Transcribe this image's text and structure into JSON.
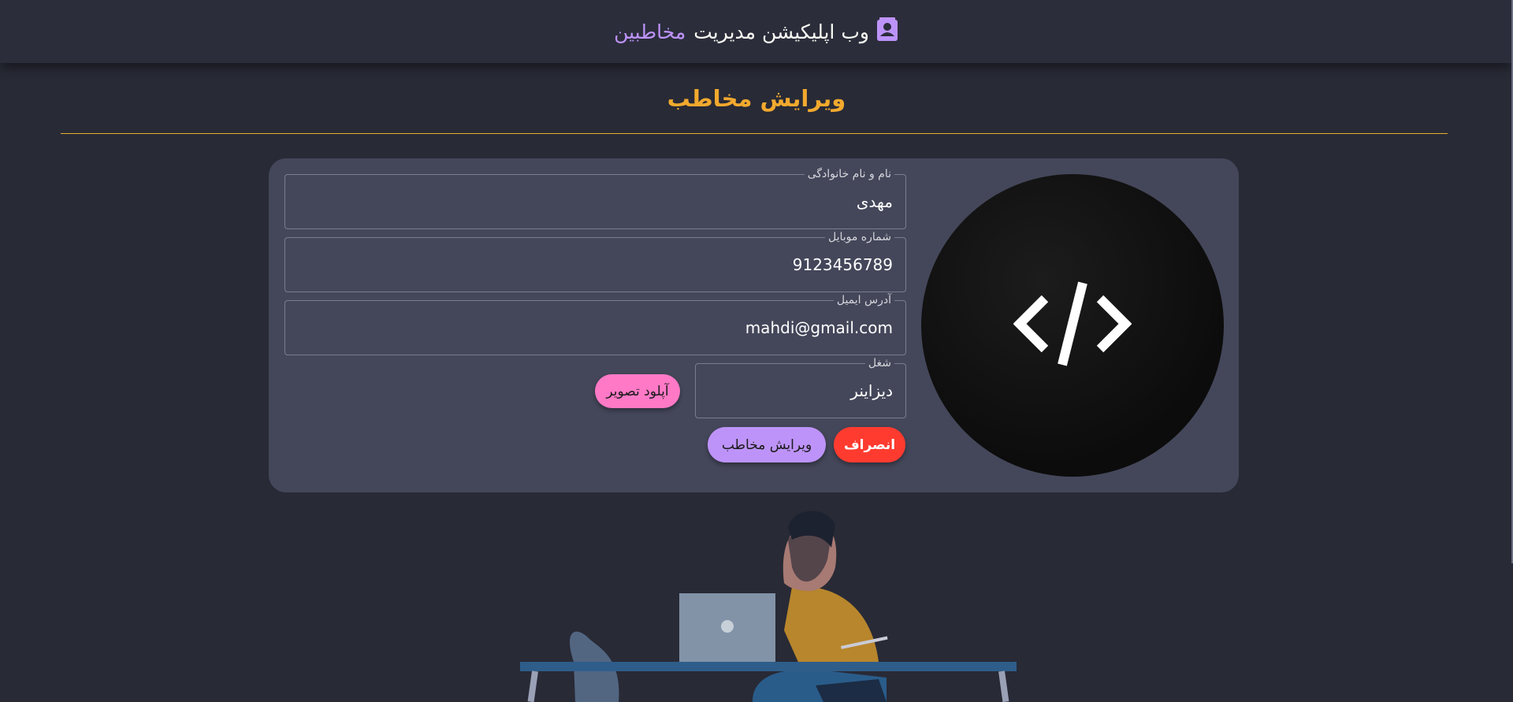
{
  "navbar": {
    "title_main": "وب اپلیکیشن مدیریت",
    "title_accent": "مخاطبین",
    "icon": "contact-book-icon"
  },
  "page": {
    "title": "ویرایش مخاطب"
  },
  "form": {
    "fullname": {
      "label": "نام و نام خانوادگی",
      "value": "مهدی"
    },
    "mobile": {
      "label": "شماره موبایل",
      "value": "9123456789"
    },
    "email": {
      "label": "آدرس ایمیل",
      "value": "mahdi@gmail.com"
    },
    "job": {
      "label": "شغل",
      "value": "دیزاینر"
    }
  },
  "buttons": {
    "upload": "آپلود تصویر",
    "edit": "ویرایش مخاطب",
    "cancel": "انصراف"
  },
  "avatar": {
    "icon": "code-icon"
  },
  "colors": {
    "background": "#282a36",
    "navbar": "#2b2d3b",
    "card": "#44475a",
    "accent_purple": "#bd93f9",
    "accent_orange": "#f1a92e",
    "pink": "#ff79c6",
    "red": "#ff3b30"
  }
}
